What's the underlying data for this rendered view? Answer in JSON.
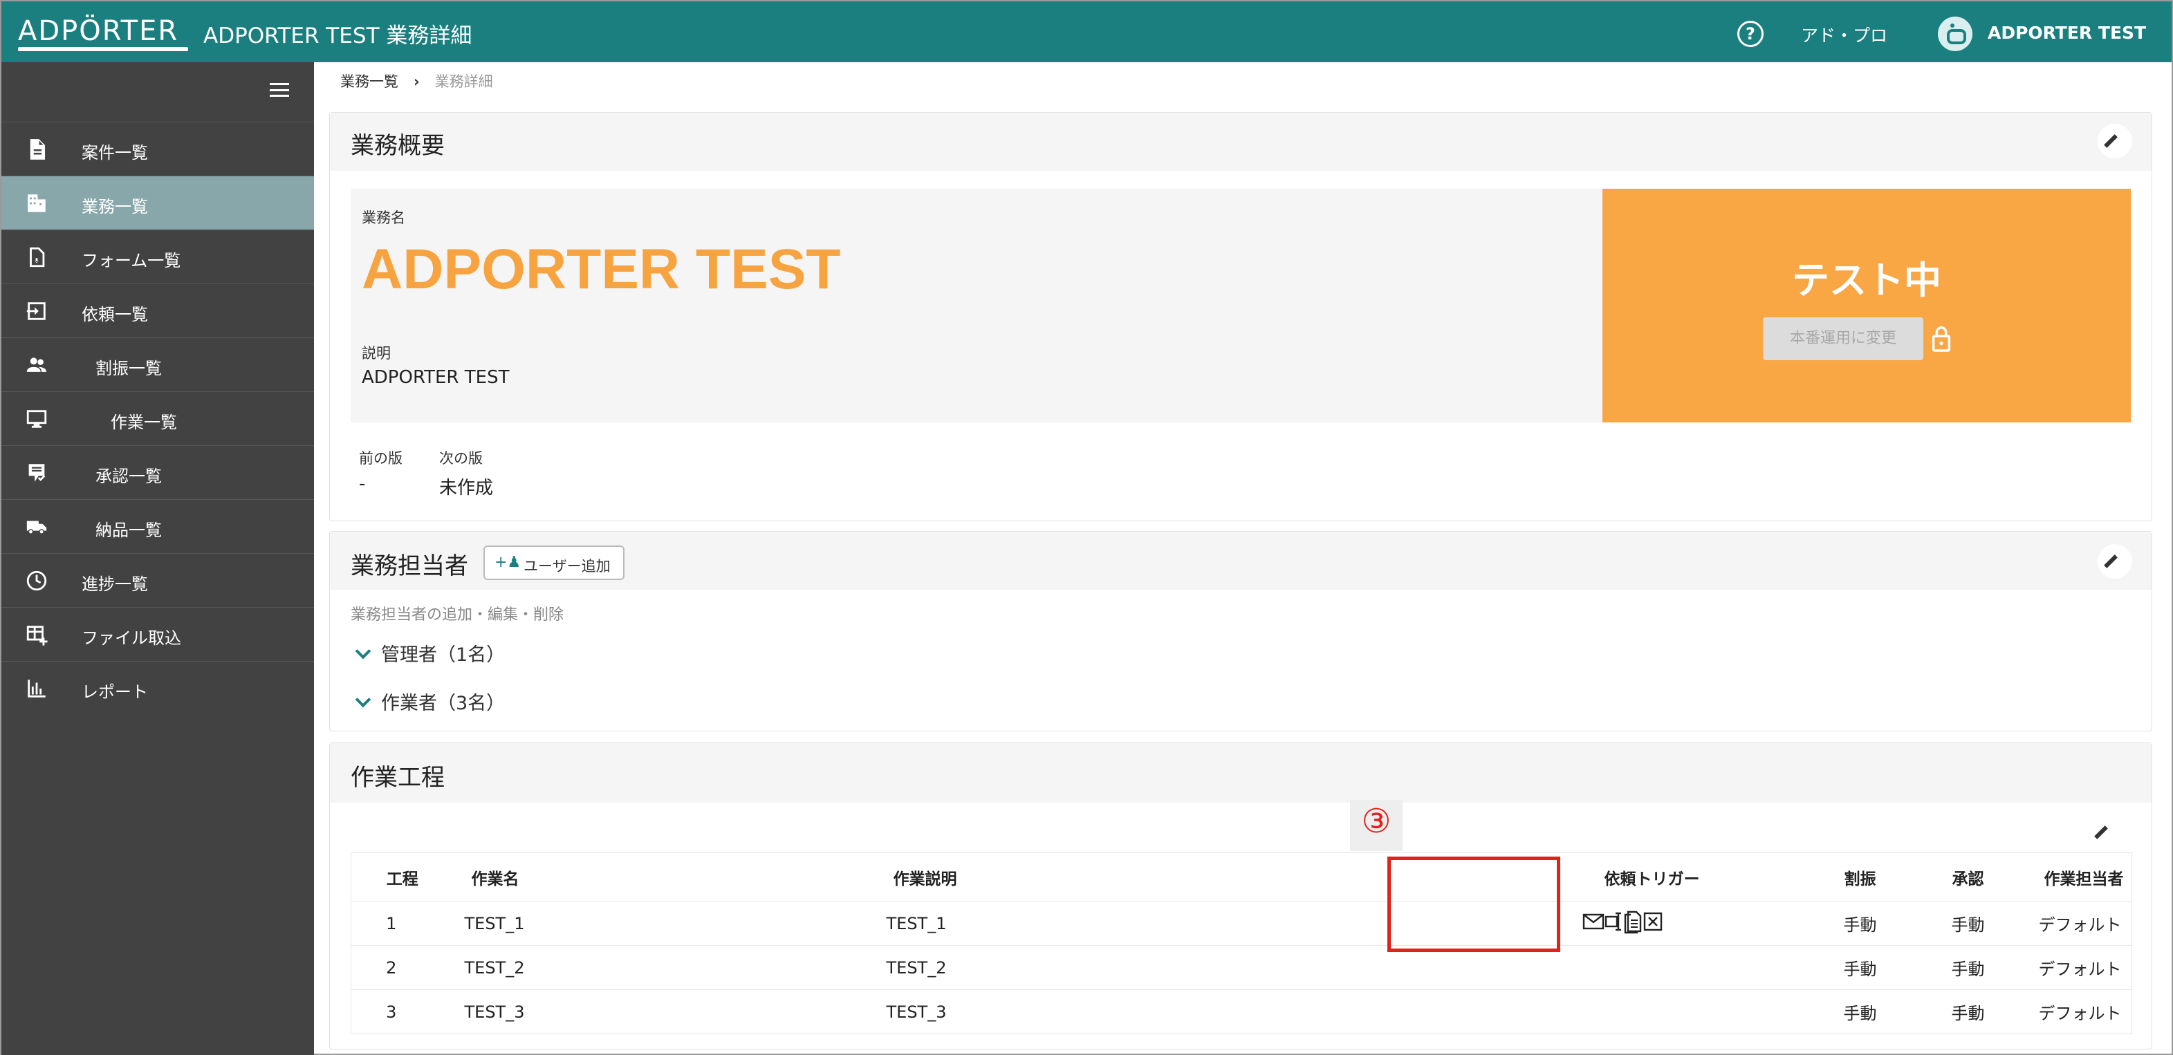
{
  "header": {
    "logo": "ADPÖRTER",
    "title": "ADPORTER TEST 業務詳細",
    "help_icon": "?",
    "link": "アド・プロ",
    "user": "ADPORTER TEST"
  },
  "sidebar": {
    "items": [
      {
        "label": "案件一覧",
        "icon": "document-icon"
      },
      {
        "label": "業務一覧",
        "icon": "building-icon"
      },
      {
        "label": "フォーム一覧",
        "icon": "form-icon"
      },
      {
        "label": "依頼一覧",
        "icon": "login-icon"
      },
      {
        "label": "割振一覧",
        "icon": "people-icon"
      },
      {
        "label": "作業一覧",
        "icon": "monitor-icon"
      },
      {
        "label": "承認一覧",
        "icon": "approve-icon"
      },
      {
        "label": "納品一覧",
        "icon": "truck-icon"
      },
      {
        "label": "進捗一覧",
        "icon": "clock-icon"
      },
      {
        "label": "ファイル取込",
        "icon": "table-add-icon"
      },
      {
        "label": "レポート",
        "icon": "bar-chart-icon"
      }
    ],
    "active_index": 1
  },
  "breadcrumb": {
    "parent": "業務一覧",
    "separator": "›",
    "current": "業務詳細"
  },
  "overview": {
    "title": "業務概要",
    "name_label": "業務名",
    "name": "ADPORTER TEST",
    "desc_label": "説明",
    "desc": "ADPORTER TEST",
    "status": "テスト中",
    "prod_button": "本番運用に変更",
    "prev_label": "前の版",
    "prev_value": "-",
    "next_label": "次の版",
    "next_value": "未作成"
  },
  "members": {
    "title": "業務担当者",
    "add_button": "ユーザー追加",
    "hint": "業務担当者の追加・編集・削除",
    "groups": [
      "管理者（1名）",
      "作業者（3名）"
    ]
  },
  "process": {
    "title": "作業工程",
    "marker": "③",
    "columns": [
      "工程",
      "作業名",
      "作業説明",
      "依頼トリガー",
      "割振",
      "承認",
      "作業担当者"
    ],
    "rows": [
      {
        "step": "1",
        "name": "TEST_1",
        "desc": "TEST_1",
        "assign": "手動",
        "approve": "手動",
        "worker": "デフォルト"
      },
      {
        "step": "2",
        "name": "TEST_2",
        "desc": "TEST_2",
        "assign": "手動",
        "approve": "手動",
        "worker": "デフォルト"
      },
      {
        "step": "3",
        "name": "TEST_3",
        "desc": "TEST_3",
        "assign": "手動",
        "approve": "手動",
        "worker": "デフォルト"
      }
    ],
    "trigger_icons": [
      "mail-icon",
      "input-icon",
      "document-icon",
      "excel-icon"
    ]
  },
  "colors": {
    "header": "#1c7f7f",
    "sidebar": "#424242",
    "active": "#88a7ab",
    "accent": "#f7a440",
    "status_bg": "#f9a744",
    "marker": "#e3211b"
  }
}
